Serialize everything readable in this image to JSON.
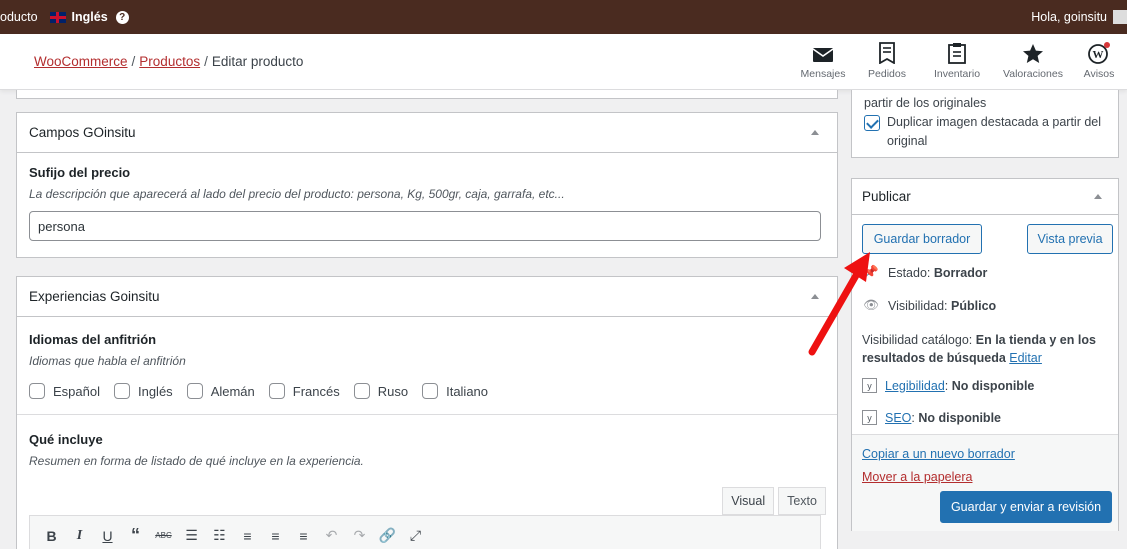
{
  "adminbar": {
    "left_text": "oducto",
    "language": "Inglés",
    "greeting": "Hola, goinsitu"
  },
  "header": {
    "breadcrumb": [
      {
        "label": "WooCommerce"
      },
      {
        "label": "Productos"
      },
      {
        "label": "Editar producto"
      }
    ],
    "icons": [
      {
        "label": "Mensajes",
        "icon": "envelope-icon"
      },
      {
        "label": "Pedidos",
        "icon": "orders-icon"
      },
      {
        "label": "Inventario",
        "icon": "inventory-icon"
      },
      {
        "label": "Valoraciones",
        "icon": "star-icon"
      },
      {
        "label": "Avisos",
        "icon": "wordpress-icon"
      }
    ]
  },
  "campos": {
    "title": "Campos GOinsitu",
    "field_label": "Sufijo del precio",
    "field_desc": "La descripción que aparecerá al lado del precio del producto: persona, Kg, 500gr, caja, garrafa, etc...",
    "value": "persona"
  },
  "experiencias": {
    "title": "Experiencias Goinsitu",
    "idiomas_label": "Idiomas del anfitrión",
    "idiomas_desc": "Idiomas que habla el anfitrión",
    "idiomas": [
      "Español",
      "Inglés",
      "Alemán",
      "Francés",
      "Ruso",
      "Italiano"
    ],
    "incluye_label": "Qué incluye",
    "incluye_desc": "Resumen en forma de listado de qué incluye en la experiencia.",
    "tab_visual": "Visual",
    "tab_text": "Texto"
  },
  "side_top": {
    "line1": "partir de los originales",
    "checkbox_label": "Duplicar imagen destacada a partir del original"
  },
  "publish": {
    "title": "Publicar",
    "save_draft": "Guardar borrador",
    "preview": "Vista previa",
    "status_label": "Estado:",
    "status_value": "Borrador",
    "visibility_label": "Visibilidad:",
    "visibility_value": "Público",
    "catalog_label": "Visibilidad catálogo:",
    "catalog_value": "En la tienda y en los resultados de búsqueda",
    "catalog_edit": "Editar",
    "legibility_link": "Legibilidad",
    "legibility_value": "No disponible",
    "seo_link": "SEO",
    "seo_value": "No disponible",
    "copy_link": "Copiar a un nuevo borrador",
    "trash_link": "Mover a la papelera",
    "submit": "Guardar y enviar a revisión"
  },
  "colors": {
    "adminbar": "#4a2b20",
    "link": "#2271b1",
    "danger": "#b32d2e",
    "annotation_arrow": "#ee1111"
  }
}
